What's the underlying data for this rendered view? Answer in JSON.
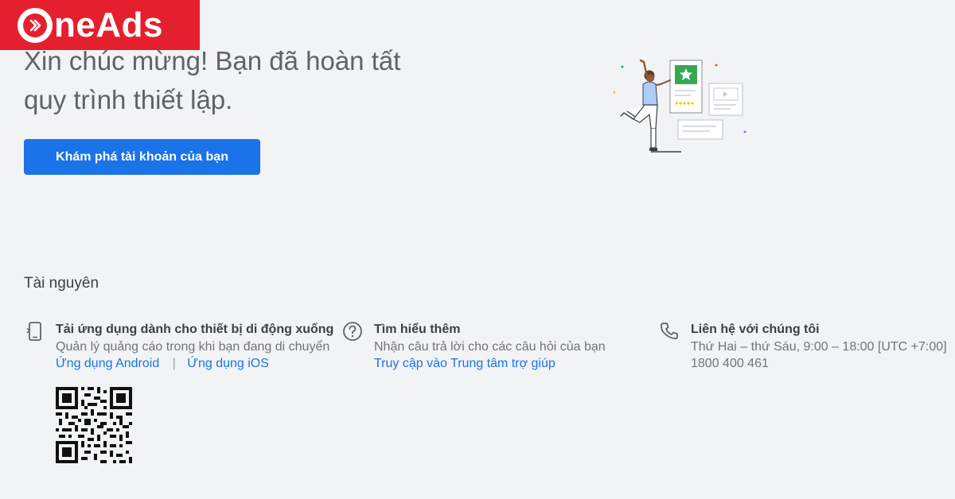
{
  "brand": {
    "name": "neAds",
    "color": "#e5202e"
  },
  "headline": {
    "line1": "Xin chúc mừng! Bạn đã hoàn tất",
    "line2": "quy trình thiết lập."
  },
  "cta": {
    "label": "Khám phá tài khoản của bạn",
    "color": "#1a73e8"
  },
  "resources": {
    "title": "Tài nguyên",
    "columns": [
      {
        "icon": "phone-icon",
        "title": "Tải ứng dụng dành cho thiết bị di động xuống",
        "description": "Quản lý quảng cáo trong khi bạn đang di chuyển",
        "links": [
          "Ứng dụng Android",
          "Ứng dụng iOS"
        ],
        "separator": "|"
      },
      {
        "icon": "help-icon",
        "title": "Tìm hiểu thêm",
        "description": "Nhận câu trả lời cho các câu hỏi của bạn",
        "link": "Truy cập vào Trung tâm trợ giúp"
      },
      {
        "icon": "phone-call-icon",
        "title": "Liên hệ với chúng tôi",
        "hours": "Thứ Hai – thứ Sáu, 9:00 – 18:00 [UTC +7:00]",
        "phone": "1800 400 461"
      }
    ]
  }
}
